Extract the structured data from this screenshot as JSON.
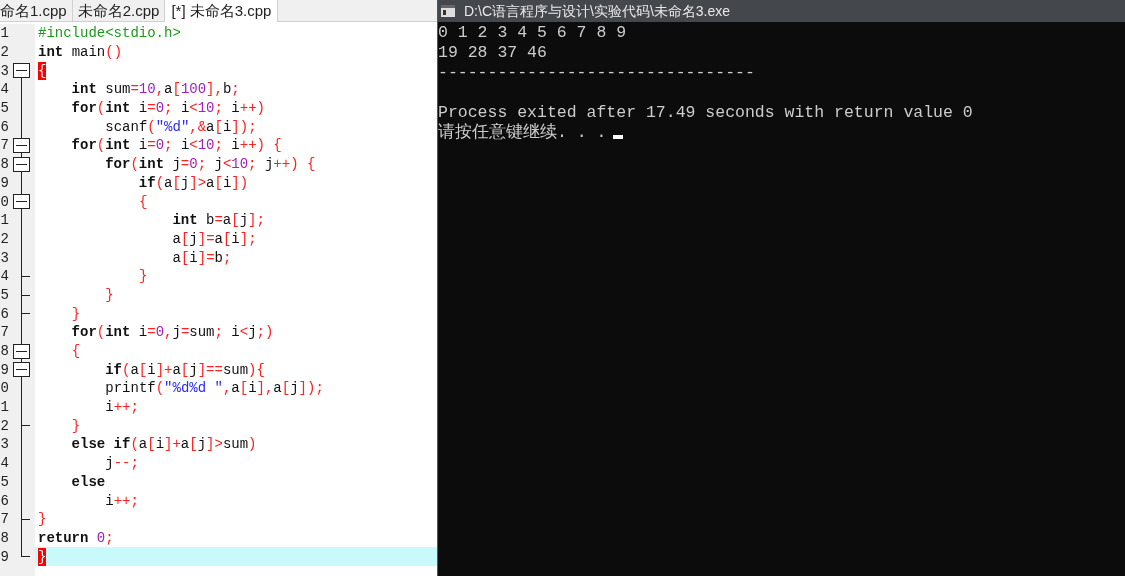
{
  "editor": {
    "tabs": [
      {
        "label": "命名1.cpp",
        "selected": false
      },
      {
        "label": "未命名2.cpp",
        "selected": false
      },
      {
        "label": "[*] 未命名3.cpp",
        "selected": true
      }
    ],
    "lines": [
      {
        "number": "1",
        "fold_start": false,
        "fold_end": false,
        "current": false,
        "segments": [
          {
            "kind": "pre",
            "text": "#include<stdio.h>"
          }
        ]
      },
      {
        "number": "2",
        "fold_start": false,
        "fold_end": false,
        "current": false,
        "segments": [
          {
            "kind": "kw",
            "text": "int"
          },
          {
            "kind": "code",
            "text": " main()"
          }
        ]
      },
      {
        "number": "3",
        "fold_start": true,
        "fold_end": false,
        "current": false,
        "segments": [
          {
            "kind": "match",
            "text": "{"
          }
        ]
      },
      {
        "number": "4",
        "fold_start": false,
        "fold_end": false,
        "current": false,
        "segments": [
          {
            "kind": "kw",
            "text": "    int"
          },
          {
            "kind": "code",
            "text": " sum=10,a[100],b;"
          }
        ]
      },
      {
        "number": "5",
        "fold_start": false,
        "fold_end": false,
        "current": false,
        "segments": [
          {
            "kind": "kw",
            "text": "    for"
          },
          {
            "kind": "code",
            "text": "("
          },
          {
            "kind": "kw",
            "text": "int"
          },
          {
            "kind": "code",
            "text": " i=0; i<10; i++)"
          }
        ]
      },
      {
        "number": "6",
        "fold_start": false,
        "fold_end": false,
        "current": false,
        "segments": [
          {
            "kind": "code",
            "text": "        scanf("
          },
          {
            "kind": "str",
            "text": "\"%d\""
          },
          {
            "kind": "code",
            "text": ",&a[i]);"
          }
        ]
      },
      {
        "number": "7",
        "fold_start": true,
        "fold_end": false,
        "current": false,
        "segments": [
          {
            "kind": "kw",
            "text": "    for"
          },
          {
            "kind": "code",
            "text": "("
          },
          {
            "kind": "kw",
            "text": "int"
          },
          {
            "kind": "code",
            "text": " i=0; i<10; i++) {"
          }
        ]
      },
      {
        "number": "8",
        "fold_start": true,
        "fold_end": false,
        "current": false,
        "segments": [
          {
            "kind": "kw",
            "text": "        for"
          },
          {
            "kind": "code",
            "text": "("
          },
          {
            "kind": "kw",
            "text": "int"
          },
          {
            "kind": "code",
            "text": " j=0; j<10; j++) {"
          }
        ]
      },
      {
        "number": "9",
        "fold_start": false,
        "fold_end": false,
        "current": false,
        "segments": [
          {
            "kind": "kw",
            "text": "            if"
          },
          {
            "kind": "code",
            "text": "(a[j]>a[i])"
          }
        ]
      },
      {
        "number": "0",
        "fold_start": true,
        "fold_end": false,
        "current": false,
        "segments": [
          {
            "kind": "code",
            "text": "            {"
          }
        ]
      },
      {
        "number": "1",
        "fold_start": false,
        "fold_end": false,
        "current": false,
        "segments": [
          {
            "kind": "kw",
            "text": "                int"
          },
          {
            "kind": "code",
            "text": " b=a[j];"
          }
        ]
      },
      {
        "number": "2",
        "fold_start": false,
        "fold_end": false,
        "current": false,
        "segments": [
          {
            "kind": "code",
            "text": "                a[j]=a[i];"
          }
        ]
      },
      {
        "number": "3",
        "fold_start": false,
        "fold_end": false,
        "current": false,
        "segments": [
          {
            "kind": "code",
            "text": "                a[i]=b;"
          }
        ]
      },
      {
        "number": "4",
        "fold_start": false,
        "fold_end": true,
        "current": false,
        "segments": [
          {
            "kind": "code",
            "text": "            }"
          }
        ]
      },
      {
        "number": "5",
        "fold_start": false,
        "fold_end": true,
        "current": false,
        "segments": [
          {
            "kind": "code",
            "text": "        }"
          }
        ]
      },
      {
        "number": "6",
        "fold_start": false,
        "fold_end": true,
        "current": false,
        "segments": [
          {
            "kind": "code",
            "text": "    }"
          }
        ]
      },
      {
        "number": "7",
        "fold_start": false,
        "fold_end": false,
        "current": false,
        "segments": [
          {
            "kind": "kw",
            "text": "    for"
          },
          {
            "kind": "code",
            "text": "("
          },
          {
            "kind": "kw",
            "text": "int"
          },
          {
            "kind": "code",
            "text": " i=0,j=sum; i<j;)"
          }
        ]
      },
      {
        "number": "8",
        "fold_start": true,
        "fold_end": false,
        "current": false,
        "segments": [
          {
            "kind": "code",
            "text": "    {"
          }
        ]
      },
      {
        "number": "9",
        "fold_start": true,
        "fold_end": false,
        "current": false,
        "segments": [
          {
            "kind": "kw",
            "text": "        if"
          },
          {
            "kind": "code",
            "text": "(a[i]+a[j]==sum){"
          }
        ]
      },
      {
        "number": "0",
        "fold_start": false,
        "fold_end": false,
        "current": false,
        "segments": [
          {
            "kind": "code",
            "text": "        printf("
          },
          {
            "kind": "str",
            "text": "\"%d%d \""
          },
          {
            "kind": "code",
            "text": ",a[i],a[j]);"
          }
        ]
      },
      {
        "number": "1",
        "fold_start": false,
        "fold_end": false,
        "current": false,
        "segments": [
          {
            "kind": "code",
            "text": "        i++;"
          }
        ]
      },
      {
        "number": "2",
        "fold_start": false,
        "fold_end": true,
        "current": false,
        "segments": [
          {
            "kind": "code",
            "text": "    }"
          }
        ]
      },
      {
        "number": "3",
        "fold_start": false,
        "fold_end": false,
        "current": false,
        "segments": [
          {
            "kind": "kw",
            "text": "    else if"
          },
          {
            "kind": "code",
            "text": "(a[i]+a[j]>sum)"
          }
        ]
      },
      {
        "number": "4",
        "fold_start": false,
        "fold_end": false,
        "current": false,
        "segments": [
          {
            "kind": "code",
            "text": "        j--;"
          }
        ]
      },
      {
        "number": "5",
        "fold_start": false,
        "fold_end": false,
        "current": false,
        "segments": [
          {
            "kind": "kw",
            "text": "    else"
          }
        ]
      },
      {
        "number": "6",
        "fold_start": false,
        "fold_end": false,
        "current": false,
        "segments": [
          {
            "kind": "code",
            "text": "        i++;"
          }
        ]
      },
      {
        "number": "7",
        "fold_start": false,
        "fold_end": true,
        "current": false,
        "segments": [
          {
            "kind": "code",
            "text": "}"
          }
        ]
      },
      {
        "number": "8",
        "fold_start": false,
        "fold_end": false,
        "current": false,
        "segments": [
          {
            "kind": "kw",
            "text": "return"
          },
          {
            "kind": "code",
            "text": " 0;"
          }
        ]
      },
      {
        "number": "9",
        "fold_start": false,
        "fold_end": true,
        "current": true,
        "segments": [
          {
            "kind": "match",
            "text": "}"
          }
        ]
      }
    ]
  },
  "console": {
    "title": "D:\\C语言程序与设计\\实验代码\\未命名3.exe",
    "lines": [
      "0 1 2 3 4 5 6 7 8 9",
      "19 28 37 46",
      "--------------------------------",
      "Process exited after 17.49 seconds with return value 0",
      "请按任意键继续. . ."
    ]
  }
}
